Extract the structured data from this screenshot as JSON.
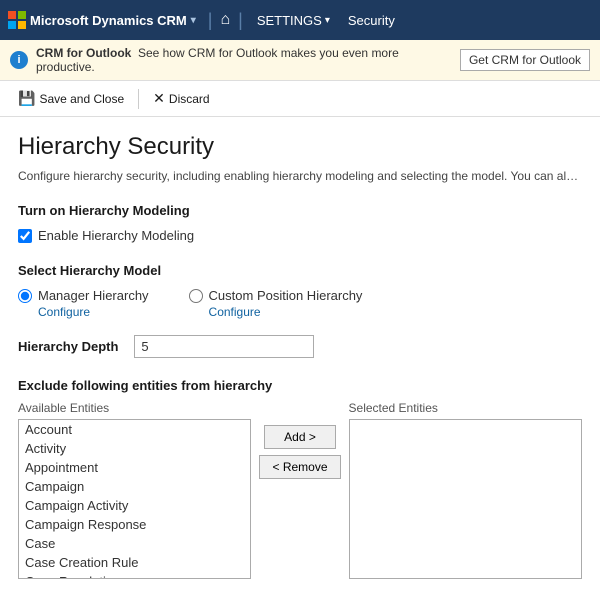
{
  "nav": {
    "logo_text": "Microsoft Dynamics CRM",
    "home_symbol": "⌂",
    "settings_label": "SETTINGS",
    "security_label": "Security",
    "caret": "▾"
  },
  "outlook_banner": {
    "info_icon": "i",
    "banner_text": "CRM for Outlook",
    "see_how_text": "See how CRM for Outlook makes you even more productive.",
    "button_label": "Get CRM for Outlook"
  },
  "toolbar": {
    "save_close_icon": "💾",
    "save_close_label": "Save and Close",
    "discard_icon": "✕",
    "discard_label": "Discard"
  },
  "page": {
    "title": "Hierarchy Security",
    "description": "Configure hierarchy security, including enabling hierarchy modeling and selecting the model. You can also specify h"
  },
  "turn_on_section": {
    "header": "Turn on Hierarchy Modeling",
    "checkbox_label": "Enable Hierarchy Modeling",
    "checkbox_checked": true
  },
  "hierarchy_model_section": {
    "header": "Select Hierarchy Model",
    "option_manager": "Manager Hierarchy",
    "option_manager_selected": true,
    "option_custom": "Custom Position Hierarchy",
    "option_custom_selected": false,
    "configure_label": "Configure"
  },
  "hierarchy_depth": {
    "label": "Hierarchy Depth",
    "value": "5"
  },
  "exclude_section": {
    "header": "Exclude following entities from hierarchy",
    "available_label": "Available Entities",
    "selected_label": "Selected Entities",
    "available_items": [
      "Account",
      "Activity",
      "Appointment",
      "Campaign",
      "Campaign Activity",
      "Campaign Response",
      "Case",
      "Case Creation Rule",
      "Case Resolution"
    ],
    "selected_items": [],
    "add_button": "Add >",
    "remove_button": "< Remove"
  }
}
